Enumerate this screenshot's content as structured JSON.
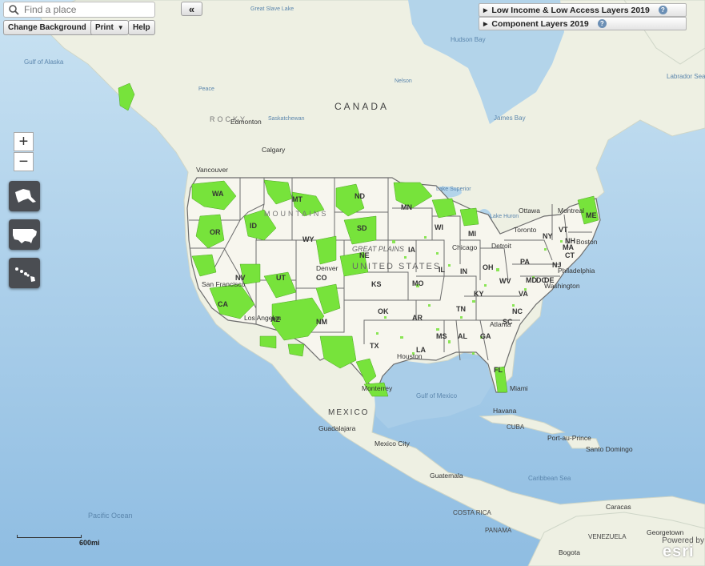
{
  "toolbar": {
    "search_placeholder": "Find a place",
    "change_background": "Change Background",
    "print": "Print",
    "help": "Help",
    "collapse": "«"
  },
  "layers": {
    "lila": "Low Income & Low Access Layers 2019",
    "component": "Component Layers 2019",
    "help_glyph": "?"
  },
  "zoom": {
    "in": "+",
    "out": "−"
  },
  "region_buttons": [
    "alaska-icon",
    "contiguous-us-icon",
    "hawaii-icon"
  ],
  "labels": {
    "canada": "CANADA",
    "mexico": "MEXICO",
    "cuba": "CUBA",
    "costa_rica": "COSTA RICA",
    "panama": "PANAMA",
    "venezuela": "VENEZUELA",
    "united_states": "UNITED STATES",
    "great_plains": "GREAT PLAINS",
    "rocky": "ROCKY",
    "mountains": "MOUNTAINS",
    "gulf_alaska": "Gulf of Alaska",
    "gulf_mexico": "Gulf of Mexico",
    "pacific": "Pacific Ocean",
    "caribbean": "Caribbean Sea",
    "hudson_bay": "Hudson Bay",
    "james_bay": "James Bay",
    "labrador_sea": "Labrador Sea",
    "lake_superior": "Lake Superior",
    "lake_huron": "Lake Huron",
    "great_slave": "Great Slave Lake",
    "peace": "Peace",
    "nelson": "Nelson",
    "saskatchewan": "Saskatchewan",
    "edmonton": "Edmonton",
    "calgary": "Calgary",
    "vancouver": "Vancouver",
    "ottawa": "Ottawa",
    "montreal": "Montreal",
    "toronto": "Toronto",
    "boston": "Boston",
    "philadelphia": "Philadelphia",
    "washington": "Washington",
    "detroit": "Detroit",
    "chicago": "Chicago",
    "denver": "Denver",
    "san_francisco": "San Francisco",
    "los_angeles": "Los Angeles",
    "houston": "Houston",
    "atlanta": "Atlanta",
    "miami": "Miami",
    "havana": "Havana",
    "monterrey": "Monterrey",
    "guadalajara": "Guadalajara",
    "mexico_city": "Mexico City",
    "guatemala": "Guatemala",
    "port_au_prince": "Port-au-Prince",
    "santo_domingo": "Santo Domingo",
    "caracas": "Caracas",
    "georgetown": "Georgetown",
    "bogota": "Bogota"
  },
  "states": [
    "WA",
    "OR",
    "CA",
    "NV",
    "ID",
    "MT",
    "WY",
    "UT",
    "AZ",
    "CO",
    "NM",
    "ND",
    "SD",
    "NE",
    "KS",
    "OK",
    "TX",
    "MN",
    "IA",
    "MO",
    "AR",
    "LA",
    "WI",
    "IL",
    "MI",
    "IN",
    "OH",
    "KY",
    "TN",
    "MS",
    "AL",
    "GA",
    "FL",
    "SC",
    "NC",
    "VA",
    "WV",
    "PA",
    "NY",
    "VT",
    "NH",
    "ME",
    "MA",
    "CT",
    "NJ",
    "DE",
    "MD",
    "DC"
  ],
  "scale": {
    "label": "600mi"
  },
  "attribution": {
    "text": "Powered by",
    "logo": "esri"
  },
  "colors": {
    "lila_tract": "#77e33b",
    "water": "#a9cde8",
    "land": "#f1f0e6",
    "boundary": "#6d6d6d"
  }
}
